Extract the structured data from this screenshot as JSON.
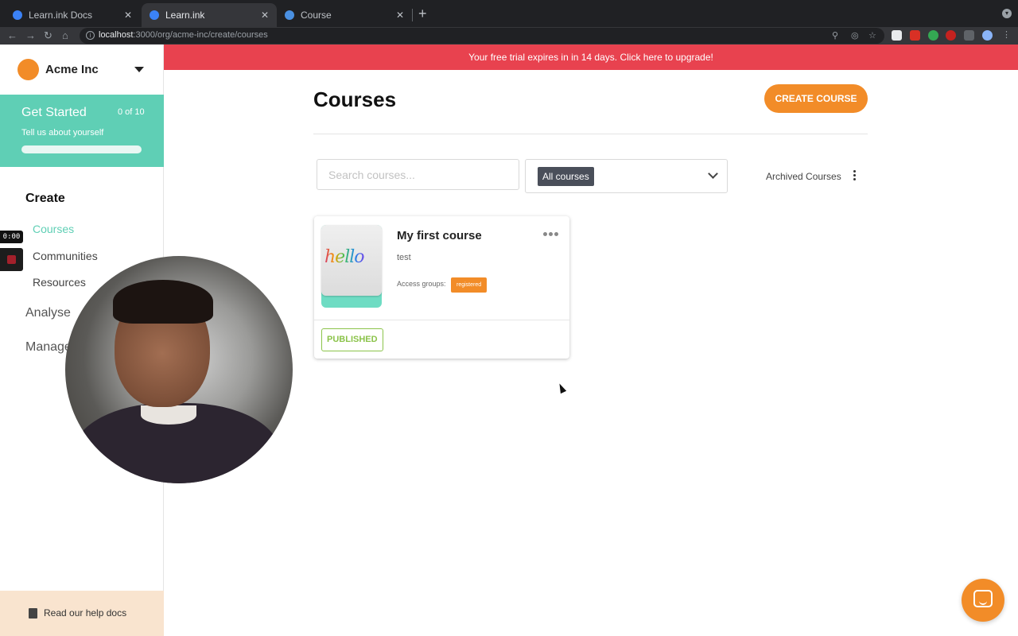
{
  "browser": {
    "tabs": [
      {
        "title": "Learn.ink Docs",
        "favicon_color": "#3b82f6"
      },
      {
        "title": "Learn.ink",
        "favicon_color": "#3b82f6",
        "active": true
      },
      {
        "title": "Course",
        "favicon_color": "#4a90e2"
      }
    ],
    "url_host": "localhost",
    "url_path": ":3000/org/acme-inc/create/courses"
  },
  "sidebar": {
    "org_name": "Acme Inc",
    "org_color": "#f28c28",
    "get_started": {
      "title": "Get Started",
      "count": "0 of 10",
      "subtitle": "Tell us about yourself",
      "progress": 0
    },
    "sections": {
      "create": "Create",
      "analyse": "Analyse",
      "manage": "Manage"
    },
    "items": [
      {
        "label": "Courses",
        "active": true
      },
      {
        "label": "Communities"
      },
      {
        "label": "Resources"
      }
    ],
    "help": "Read our help docs"
  },
  "recorder": {
    "timer": "0:00"
  },
  "banner": "Your free trial expires in in 14 days. Click here to upgrade!",
  "main": {
    "title": "Courses",
    "create_button": "CREATE COURSE",
    "search_placeholder": "Search courses...",
    "filter_value": "All courses",
    "archived": "Archived Courses"
  },
  "courses": [
    {
      "title": "My first course",
      "thumbnail_text": "hello",
      "description": "test",
      "access_label": "Access groups:",
      "access_group": "registered",
      "status": "PUBLISHED"
    }
  ],
  "colors": {
    "accent_orange": "#f28c28",
    "accent_teal": "#5fcfb5",
    "banner_red": "#e8424f",
    "published_green": "#8bc34a"
  }
}
